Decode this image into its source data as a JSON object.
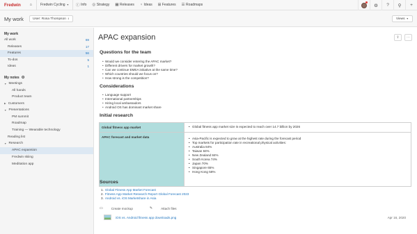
{
  "nav": {
    "logo": "Fredwin",
    "product": "Fredwin Cycling",
    "items": [
      {
        "label": "Info",
        "icon": "info-icon"
      },
      {
        "label": "Strategy",
        "icon": "strategy-icon"
      },
      {
        "label": "Releases",
        "icon": "calendar-icon"
      },
      {
        "label": "Ideas",
        "icon": "lightbulb-icon"
      },
      {
        "label": "Features",
        "icon": "grid-icon"
      },
      {
        "label": "Roadmaps",
        "icon": "roadmap-icon"
      }
    ]
  },
  "header": {
    "title": "My work",
    "user_filter": "User: Rosa Thompson",
    "views": "Views"
  },
  "sidebar": {
    "my_work_heading": "My work",
    "all_work": {
      "label": "All work",
      "count": "69"
    },
    "work_items": [
      {
        "label": "Releases",
        "count": "17"
      },
      {
        "label": "Features",
        "count": "56"
      },
      {
        "label": "To-dos",
        "count": "5"
      },
      {
        "label": "Ideas",
        "count": "1"
      }
    ],
    "notes_heading": "My notes",
    "notes": [
      {
        "label": "Meetings",
        "level": 0,
        "expand": "open"
      },
      {
        "label": "All hands",
        "level": 2,
        "expand": ""
      },
      {
        "label": "Product team",
        "level": 2,
        "expand": ""
      },
      {
        "label": "Customers",
        "level": 0,
        "expand": "closed"
      },
      {
        "label": "Presentations",
        "level": 0,
        "expand": "open"
      },
      {
        "label": "PM summit",
        "level": 2,
        "expand": ""
      },
      {
        "label": "Roadmap",
        "level": 2,
        "expand": ""
      },
      {
        "label": "Training — Wearable technology",
        "level": 2,
        "expand": ""
      },
      {
        "label": "Reading list",
        "level": 1,
        "expand": ""
      },
      {
        "label": "Research",
        "level": 0,
        "expand": "open"
      },
      {
        "label": "APAC expansion",
        "level": 2,
        "expand": "",
        "active": true
      },
      {
        "label": "Fredwin skiing",
        "level": 2,
        "expand": ""
      },
      {
        "label": "Meditation app",
        "level": 2,
        "expand": ""
      }
    ]
  },
  "doc": {
    "title": "APAC expansion",
    "questions_heading": "Questions for the team",
    "questions": [
      "Would we consider entering the APAC market?",
      "Different drivers for market growth?",
      "Can we continue EMEA initiative at the same time?",
      "Which countries should we focus on?",
      "How strong is the competition?"
    ],
    "considerations_heading": "Considerations",
    "considerations": [
      "Language support",
      "International partnerships",
      "Hiring local ambassadors",
      "Android OS has dominant market share"
    ],
    "research_heading": "Initial research",
    "research_rows": [
      {
        "label": "Global fitness app market",
        "text": "Global fitness app market size is expected to reach over 14.7 billion by 2026"
      },
      {
        "label": "APAC forecast and market data"
      }
    ],
    "apac_points": [
      "Asia-Pacific is expected to grow at the highest rate during the forecast period",
      "Top markets for participation rate in recreational physical activities:"
    ],
    "apac_markets": [
      "Australia 84%",
      "Taiwan 84%",
      "New Zealand 84%",
      "South Korea 74%",
      "Japan 70%",
      "Singapore 65%",
      "Hong Kong 58%"
    ],
    "sources_heading": "Sources",
    "sources": [
      {
        "num": "1.",
        "text": "Global Fitness App Market Forecast"
      },
      {
        "num": "2.",
        "text": "Fitness App Market Research Report Global Forecast 2023"
      },
      {
        "num": "3.",
        "text": "Android vs. iOS Marketshare in Asia"
      }
    ],
    "create_mockup": "Create mockup",
    "attach_files": "Attach files",
    "attachment": {
      "name": "iOS vs. Android fitness app downloads.png",
      "date": "Apr 16, 2020"
    }
  }
}
